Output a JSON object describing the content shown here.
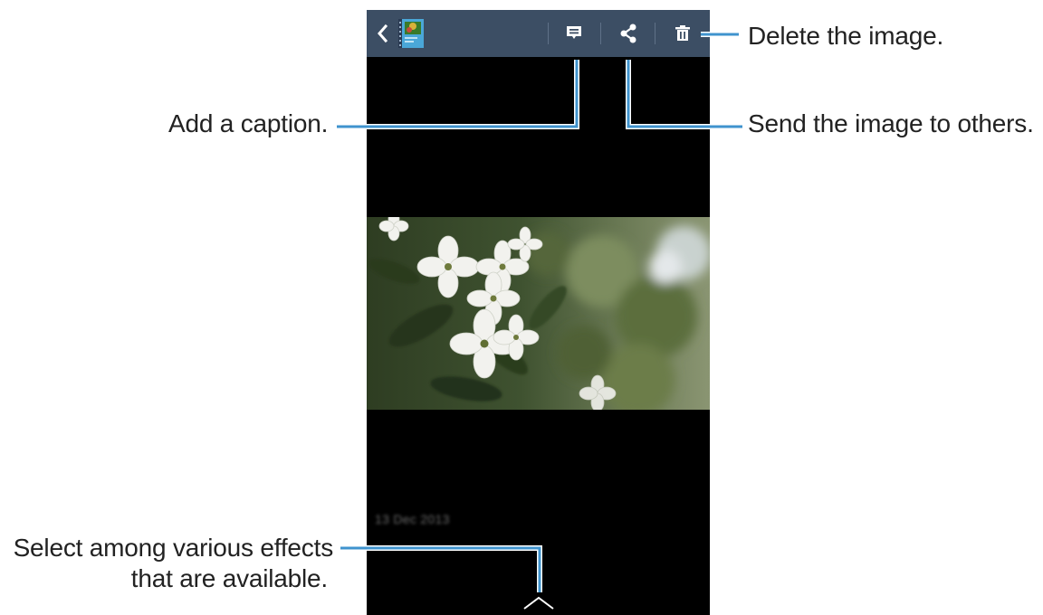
{
  "viewer": {
    "date_label": "13 Dec 2013",
    "icons": {
      "back": "back-arrow-icon",
      "album": "album-thumbnail-icon",
      "caption": "caption-icon",
      "share": "share-icon",
      "delete": "trash-icon",
      "expand": "chevron-up-icon"
    }
  },
  "callouts": {
    "caption": "Add a caption.",
    "delete": "Delete the image.",
    "share": "Send the image to others.",
    "effects_line1": "Select among various effects",
    "effects_line2": "that are available."
  },
  "colors": {
    "action_bar": "#3c4e64",
    "leader_line": "#3f93ce",
    "screen_background": "#000000"
  }
}
